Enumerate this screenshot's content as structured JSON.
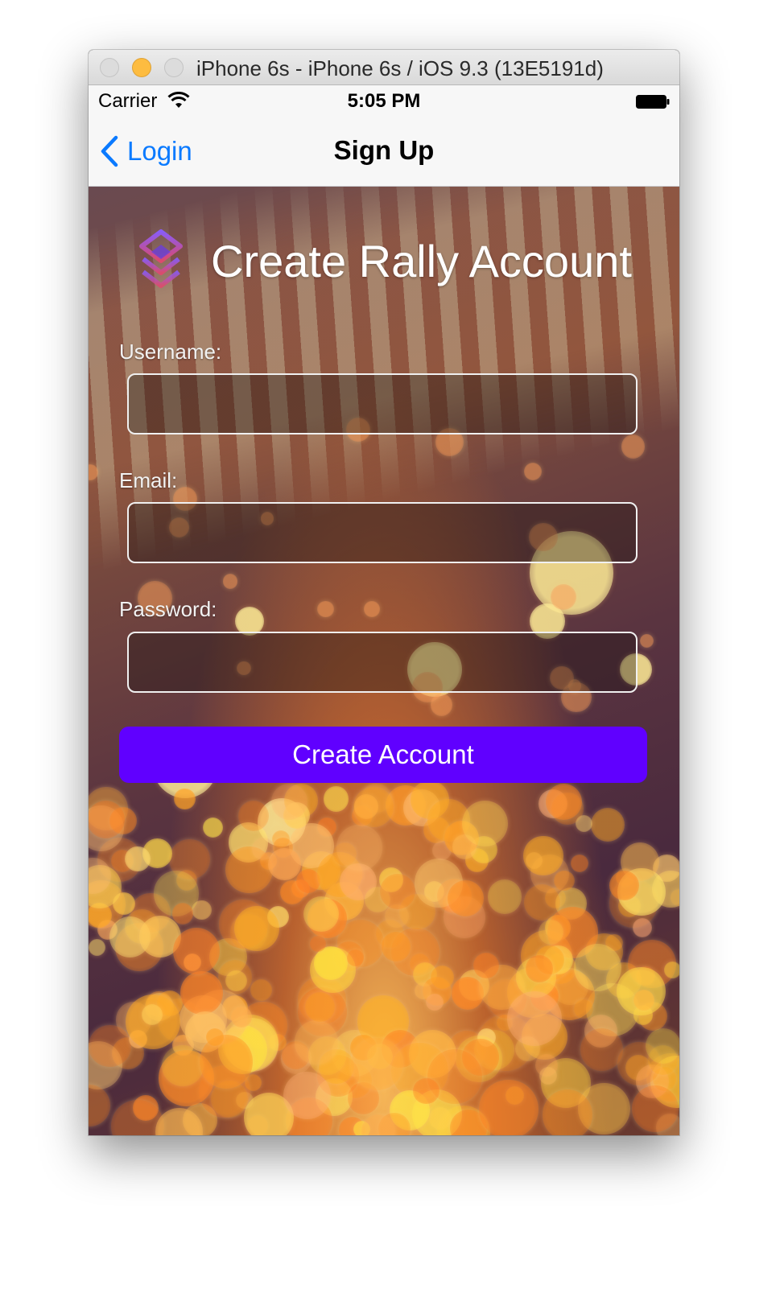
{
  "window": {
    "title": "iPhone 6s - iPhone 6s / iOS 9.3 (13E5191d)"
  },
  "status_bar": {
    "carrier": "Carrier",
    "time": "5:05 PM"
  },
  "nav_bar": {
    "back_label": "Login",
    "title": "Sign Up"
  },
  "form": {
    "headline": "Create Rally Account",
    "username_label": "Username:",
    "username_value": "",
    "email_label": "Email:",
    "email_value": "",
    "password_label": "Password:",
    "password_value": "",
    "submit_label": "Create Account"
  },
  "colors": {
    "accent_button": "#6000ff",
    "ios_tint": "#0a7aff"
  }
}
